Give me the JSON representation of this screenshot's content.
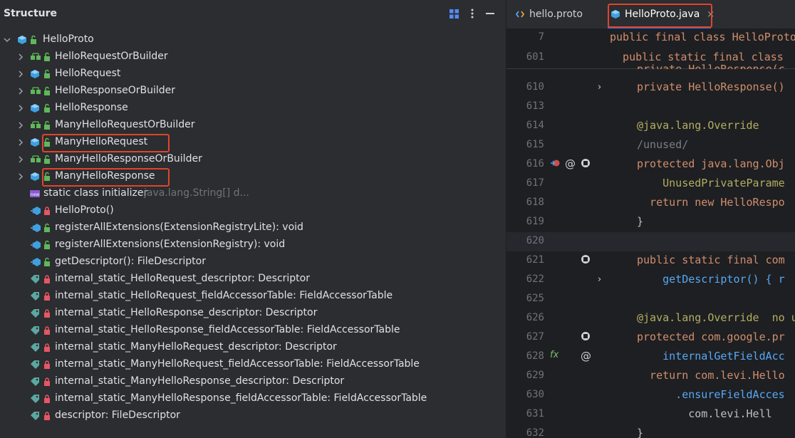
{
  "structure": {
    "title": "Structure",
    "root": "HelloProto",
    "items": [
      {
        "label": "HelloRequestOrBuilder",
        "kind": "interface",
        "expandable": true
      },
      {
        "label": "HelloRequest",
        "kind": "class",
        "expandable": true
      },
      {
        "label": "HelloResponseOrBuilder",
        "kind": "interface",
        "expandable": true
      },
      {
        "label": "HelloResponse",
        "kind": "class",
        "expandable": true
      },
      {
        "label": "ManyHelloRequestOrBuilder",
        "kind": "interface",
        "expandable": true
      },
      {
        "label": "ManyHelloRequest",
        "kind": "class",
        "expandable": true,
        "highlighted": true
      },
      {
        "label": "ManyHelloResponseOrBuilder",
        "kind": "interface",
        "expandable": true
      },
      {
        "label": "ManyHelloResponse",
        "kind": "class",
        "expandable": true,
        "highlighted": true
      },
      {
        "label": "static class initializer",
        "suffix": "java.lang.String[] d...",
        "kind": "initializer",
        "expandable": false
      },
      {
        "label": "HelloProto()",
        "kind": "method-private",
        "expandable": false
      },
      {
        "label": "registerAllExtensions(ExtensionRegistryLite): void",
        "kind": "method-public",
        "expandable": false
      },
      {
        "label": "registerAllExtensions(ExtensionRegistry): void",
        "kind": "method-public",
        "expandable": false
      },
      {
        "label": "getDescriptor(): FileDescriptor",
        "kind": "method-public",
        "expandable": false
      },
      {
        "label": "internal_static_HelloRequest_descriptor: Descriptor",
        "kind": "field",
        "expandable": false
      },
      {
        "label": "internal_static_HelloRequest_fieldAccessorTable: FieldAccessorTable",
        "kind": "field",
        "expandable": false
      },
      {
        "label": "internal_static_HelloResponse_descriptor: Descriptor",
        "kind": "field",
        "expandable": false
      },
      {
        "label": "internal_static_HelloResponse_fieldAccessorTable: FieldAccessorTable",
        "kind": "field",
        "expandable": false
      },
      {
        "label": "internal_static_ManyHelloRequest_descriptor: Descriptor",
        "kind": "field",
        "expandable": false
      },
      {
        "label": "internal_static_ManyHelloRequest_fieldAccessorTable: FieldAccessorTable",
        "kind": "field",
        "expandable": false
      },
      {
        "label": "internal_static_ManyHelloResponse_descriptor: Descriptor",
        "kind": "field",
        "expandable": false
      },
      {
        "label": "internal_static_ManyHelloResponse_fieldAccessorTable: FieldAccessorTable",
        "kind": "field",
        "expandable": false
      },
      {
        "label": "descriptor: FileDescriptor",
        "kind": "field",
        "expandable": false
      }
    ]
  },
  "editor": {
    "tabs": [
      {
        "label": "hello.proto",
        "active": false
      },
      {
        "label": "HelloProto.java",
        "active": true,
        "close": "×"
      }
    ],
    "sticky": [
      {
        "ln": "7",
        "text": "public final class HelloProto"
      },
      {
        "ln": "601",
        "text": "  public static final class"
      }
    ],
    "lines": [
      {
        "ln": "610",
        "text": "private HelloResponse()"
      },
      {
        "ln": "613",
        "text": ""
      },
      {
        "ln": "614",
        "text": "@java.lang.Override"
      },
      {
        "ln": "615",
        "text": "/unused/"
      },
      {
        "ln": "616",
        "text": "protected java.lang.Obj"
      },
      {
        "ln": "617",
        "text": "    UnusedPrivateParame"
      },
      {
        "ln": "618",
        "text": "  return new HelloRespo"
      },
      {
        "ln": "619",
        "text": "}"
      },
      {
        "ln": "620",
        "text": ""
      },
      {
        "ln": "621",
        "text": "public static final com"
      },
      {
        "ln": "622",
        "text": "    getDescriptor() { r"
      },
      {
        "ln": "625",
        "text": ""
      },
      {
        "ln": "626",
        "text": "@java.lang.Override  no u"
      },
      {
        "ln": "627",
        "text": "protected com.google.pr"
      },
      {
        "ln": "628",
        "text": "    internalGetFieldAcc"
      },
      {
        "ln": "629",
        "text": "  return com.levi.Hello"
      },
      {
        "ln": "630",
        "text": "      .ensureFieldAcces"
      },
      {
        "ln": "631",
        "text": "        com.levi.Hell"
      },
      {
        "ln": "632",
        "text": "}"
      }
    ],
    "partial_line": "private HelloResponse(c"
  },
  "colors": {
    "highlight": "#e0442c",
    "accent": "#3574f0",
    "keyword": "#cf8e6d",
    "function": "#56a8f5",
    "annotation": "#b3ae60"
  }
}
